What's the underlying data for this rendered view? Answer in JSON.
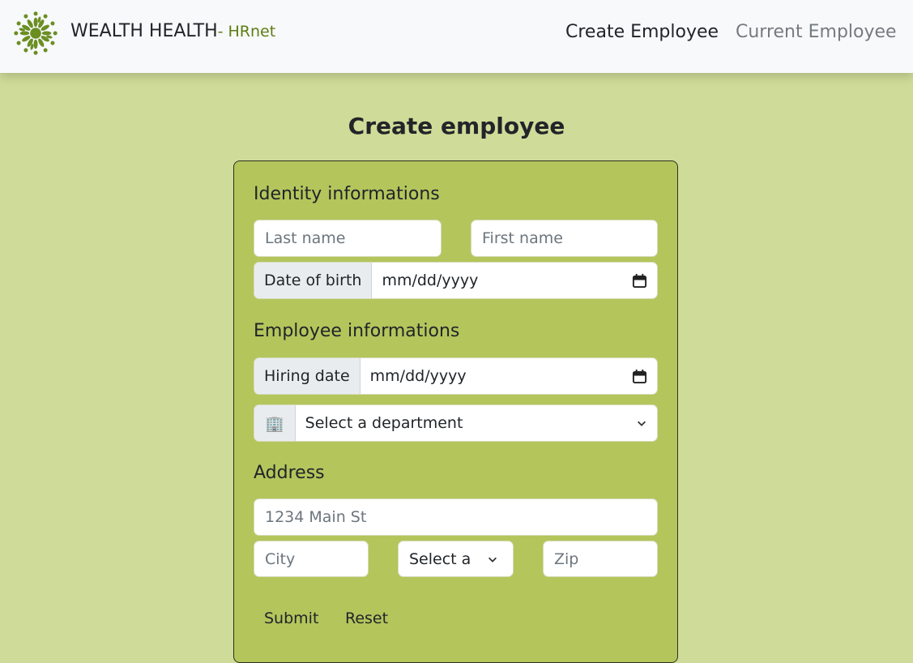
{
  "navbar": {
    "brand_name": "WEALTH HEALTH",
    "brand_sub": "- HRnet",
    "links": [
      "Create Employee",
      "Current Employee"
    ]
  },
  "page": {
    "title": "Create employee"
  },
  "identity": {
    "title": "Identity informations",
    "last_name_placeholder": "Last name",
    "first_name_placeholder": "First name",
    "dob_label": "Date of birth",
    "dob_value": "mm/dd/yyyy"
  },
  "employee": {
    "title": "Employee informations",
    "hiring_label": "Hiring date",
    "hiring_value": "mm/dd/yyyy",
    "department_icon": "🏢",
    "department_value": "Select a department"
  },
  "address": {
    "title": "Address",
    "street_placeholder": "1234 Main St",
    "city_placeholder": "City",
    "state_value": "Select a",
    "zip_placeholder": "Zip"
  },
  "buttons": {
    "submit": "Submit",
    "reset": "Reset"
  },
  "colors": {
    "background": "#cfdb98",
    "card": "#b4c55c",
    "brand_accent": "#5c7d12",
    "logo": "#6b8e23"
  }
}
